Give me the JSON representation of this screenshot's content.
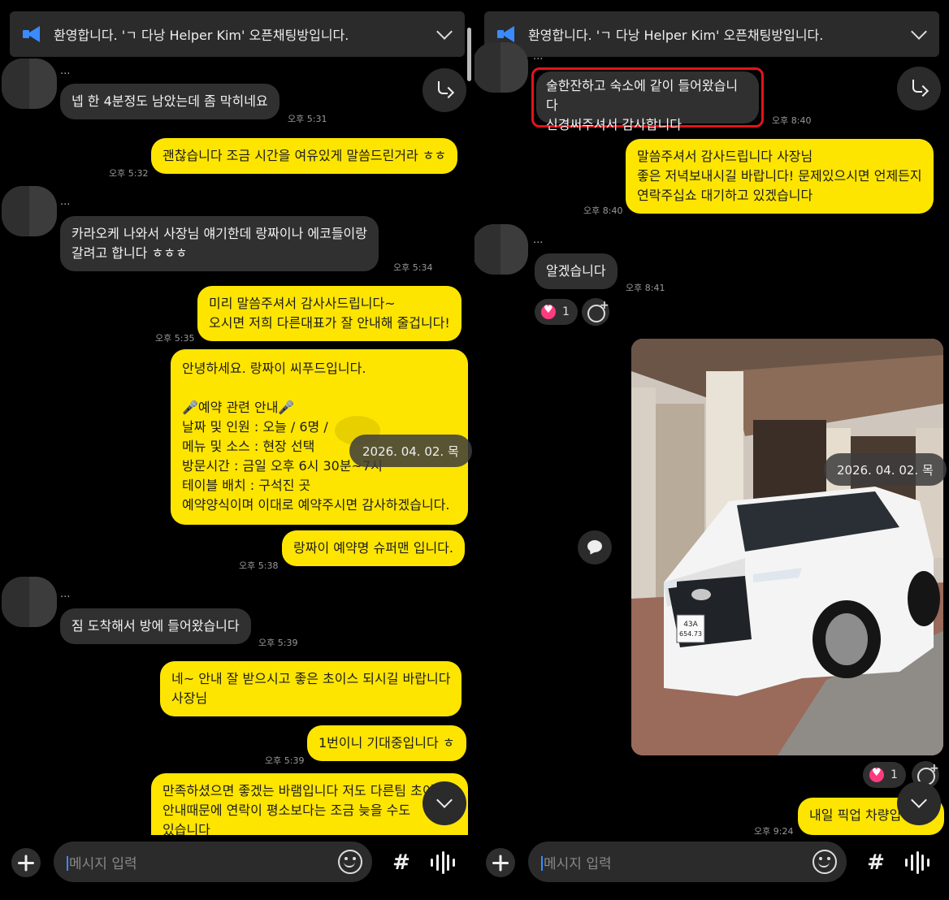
{
  "notice": {
    "text": "환영합니다. 'ㄱ 다낭 Helper Kim' 오픈채팅방입니다."
  },
  "sender_name_placeholder": "...",
  "left": {
    "messages": [
      {
        "text": "넵 한 4분정도 남았는데 좀 막히네요",
        "time": "오후 5:31"
      },
      {
        "text": "괜찮습니다 조금 시간을 여유있게 말씀드린거라 ㅎㅎ",
        "time": "오후 5:32"
      },
      {
        "text": "카라오케 나와서 사장님 얘기한데 랑짜이나 에코들이랑\n갈려고 합니다 ㅎㅎㅎ",
        "time": "오후 5:34"
      },
      {
        "text": "미리 말씀주셔서 감사사드립니다~\n오시면 저희 다른대표가 잘 안내해 줄겁니다!",
        "time": "오후 5:35"
      },
      {
        "text": "안녕하세요. 랑짜이 씨푸드입니다.\n\n🎤예약 관련 안내🎤\n날짜 및 인원 : 오늘 / 6명 / \n메뉴 및 소스 : 현장 선택\n방문시간 : 금일 오후 6시 30분~7시\n테이블 배치 : 구석진 곳\n예약양식이며 이대로 예약주시면 감사하겠습니다."
      },
      {
        "text": "랑짜이 예약명 슈퍼맨 입니다.",
        "time": "오후 5:38"
      },
      {
        "text": "짐 도착해서 방에 들어왔습니다",
        "time": "오후 5:39"
      },
      {
        "text": "네~ 안내 잘 받으시고 좋은 초이스 되시길 바랍니다\n사장님"
      },
      {
        "text": "1번이니 기대중입니다 ㅎ",
        "time": "오후 5:39"
      },
      {
        "text": "만족하셨으면 좋겠는 바램입니다 저도 다른팀 초이스\n안내때문에 연락이 평소보다는 조금 늦을 수도\n있습니다"
      }
    ],
    "date_pill": "2026. 04. 02. 목"
  },
  "right": {
    "messages": [
      {
        "text": "술한잔하고 숙소에 같이 들어왔습니다\n신경써주셔서 감사합니다",
        "time": "오후 8:40"
      },
      {
        "text": "말씀주셔서 감사드립니다 사장님\n좋은 저녁보내시길 바랍니다! 문제있으시면 언제든지\n연락주십쇼 대기하고 있겠습니다",
        "time": "오후 8:40"
      },
      {
        "text": "알겠습니다",
        "time": "오후 8:41"
      },
      {
        "text": "내일 픽업 차량입니다",
        "time": "오후 9:24"
      }
    ],
    "reaction_count_1": "1",
    "reaction_count_2": "1",
    "date_pill": "2026. 04. 02. 목",
    "plate": "43A\n654.73"
  },
  "input": {
    "placeholder": "메시지 입력"
  },
  "icons": {
    "notice": "megaphone-icon",
    "share": "share-arrow-icon",
    "scroll_down": "chevron-down-icon",
    "attach": "plus-icon",
    "emoji": "emoji-icon",
    "hashtag": "hashtag-icon",
    "voice": "voice-wave-icon"
  },
  "colors": {
    "my_bubble": "#fee500",
    "their_bubble": "#303030",
    "background": "#000000",
    "highlight": "#e3141b",
    "heart": "#ff3b7f",
    "notice_icon": "#3a8bff"
  }
}
